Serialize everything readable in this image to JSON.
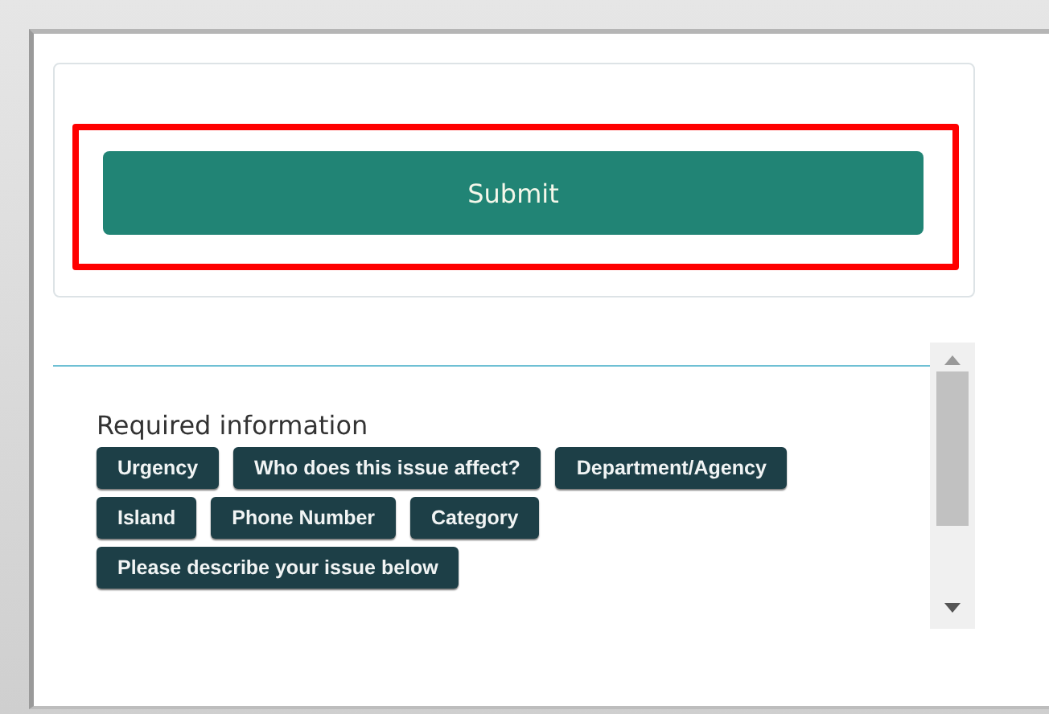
{
  "submit": {
    "label": "Submit",
    "highlighted": true
  },
  "required": {
    "label": "Required information",
    "tags": [
      "Urgency",
      "Who does this issue affect?",
      "Department/Agency",
      "Island",
      "Phone Number",
      "Category",
      "Please describe your issue below"
    ]
  }
}
